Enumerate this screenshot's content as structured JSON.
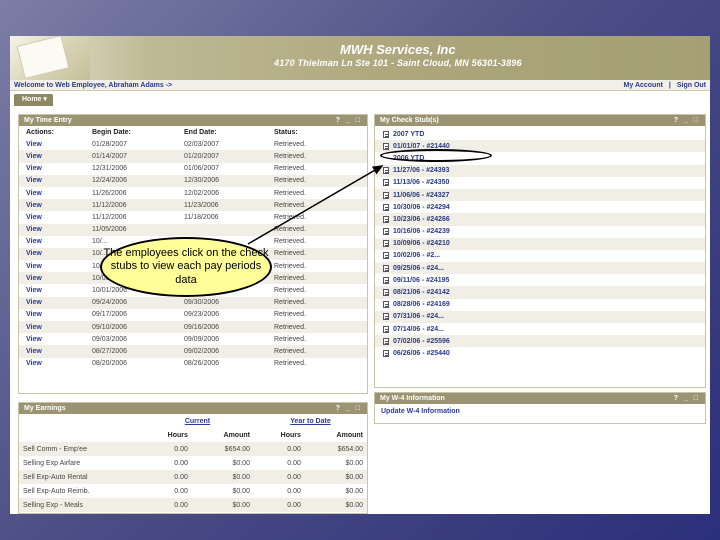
{
  "app": {
    "company_name": "MWH Services, Inc",
    "company_address": "4170 Thielman Ln Ste 101 - Saint Cloud, MN 56301-3896",
    "welcome": "Welcome to Web Employee, Abraham Adams ->",
    "links": {
      "my_account": "My Account",
      "separator": "|",
      "sign_out": "Sign Out"
    },
    "tab": "Home"
  },
  "time_entry": {
    "title": "My Time Entry",
    "controls": "? _ □",
    "headers": [
      "Actions:",
      "Begin Date:",
      "End Date:",
      "Status:"
    ],
    "rows": [
      {
        "action": "View",
        "begin": "01/28/2007",
        "end": "02/03/2007",
        "status": "Retrieved."
      },
      {
        "action": "View",
        "begin": "01/14/2007",
        "end": "01/20/2007",
        "status": "Retrieved."
      },
      {
        "action": "View",
        "begin": "12/31/2006",
        "end": "01/06/2007",
        "status": "Retrieved."
      },
      {
        "action": "View",
        "begin": "12/24/2006",
        "end": "12/30/2006",
        "status": "Retrieved."
      },
      {
        "action": "View",
        "begin": "11/26/2006",
        "end": "12/02/2006",
        "status": "Retrieved."
      },
      {
        "action": "View",
        "begin": "11/12/2006",
        "end": "11/23/2006",
        "status": "Retrieved."
      },
      {
        "action": "View",
        "begin": "11/12/2006",
        "end": "11/18/2006",
        "status": "Retrieved."
      },
      {
        "action": "View",
        "begin": "11/05/2006",
        "end": "",
        "status": "Retrieved."
      },
      {
        "action": "View",
        "begin": "10/...",
        "end": "",
        "status": "Retrieved."
      },
      {
        "action": "View",
        "begin": "10/...",
        "end": "",
        "status": "Retrieved."
      },
      {
        "action": "View",
        "begin": "10/...",
        "end": "",
        "status": "Retrieved."
      },
      {
        "action": "View",
        "begin": "10/08/2006",
        "end": "",
        "status": "Retrieved."
      },
      {
        "action": "View",
        "begin": "10/01/2006",
        "end": "10/07/2006",
        "status": "Retrieved."
      },
      {
        "action": "View",
        "begin": "09/24/2006",
        "end": "09/30/2006",
        "status": "Retrieved."
      },
      {
        "action": "View",
        "begin": "09/17/2006",
        "end": "09/23/2006",
        "status": "Retrieved."
      },
      {
        "action": "View",
        "begin": "09/10/2006",
        "end": "09/16/2006",
        "status": "Retrieved."
      },
      {
        "action": "View",
        "begin": "09/03/2006",
        "end": "09/09/2006",
        "status": "Retrieved."
      },
      {
        "action": "View",
        "begin": "08/27/2006",
        "end": "09/02/2006",
        "status": "Retrieved."
      },
      {
        "action": "View",
        "begin": "08/20/2006",
        "end": "08/26/2006",
        "status": "Retrieved."
      }
    ]
  },
  "check_stubs": {
    "title": "My Check Stub(s)",
    "controls": "? _ □",
    "items": [
      {
        "label": "2007 YTD",
        "icon": true
      },
      {
        "label": "01/01/07 - #21440",
        "icon": true
      },
      {
        "label": "2006 YTD",
        "icon": false
      },
      {
        "label": "11/27/06 - #24393",
        "icon": true
      },
      {
        "label": "11/13/06 - #24350",
        "icon": true
      },
      {
        "label": "11/06/06 - #24327",
        "icon": true
      },
      {
        "label": "10/30/06 - #24294",
        "icon": true
      },
      {
        "label": "10/23/06 - #24266",
        "icon": true
      },
      {
        "label": "10/16/06 - #24239",
        "icon": true
      },
      {
        "label": "10/09/06 - #24210",
        "icon": true
      },
      {
        "label": "10/02/06 - #2...",
        "icon": true
      },
      {
        "label": "09/25/06 - #24...",
        "icon": true
      },
      {
        "label": "09/11/06 - #24195",
        "icon": true
      },
      {
        "label": "08/21/06 - #24142",
        "icon": true
      },
      {
        "label": "08/28/06 - #24169",
        "icon": true
      },
      {
        "label": "07/31/06 - #24...",
        "icon": true
      },
      {
        "label": "07/14/06 - #24...",
        "icon": true
      },
      {
        "label": "07/02/06 - #25596",
        "icon": true
      },
      {
        "label": "06/26/06 - #25440",
        "icon": true
      }
    ]
  },
  "w4": {
    "title": "My W-4 Information",
    "controls": "? _ □",
    "link": "Update W-4 Information"
  },
  "earnings": {
    "title": "My Earnings",
    "controls": "? _ □",
    "group_headers": [
      "Current",
      "Year to Date"
    ],
    "col_headers": [
      "Hours",
      "Amount",
      "Hours",
      "Amount"
    ],
    "rows": [
      {
        "name": "Sell Comm - Emp'ee",
        "h1": "0.00",
        "a1": "$654.00",
        "h2": "0.00",
        "a2": "$654.00"
      },
      {
        "name": "Selling Exp Airfare",
        "h1": "0.00",
        "a1": "$0.00",
        "h2": "0.00",
        "a2": "$0.00"
      },
      {
        "name": "Sell Exp-Auto Rental",
        "h1": "0.00",
        "a1": "$0.00",
        "h2": "0.00",
        "a2": "$0.00"
      },
      {
        "name": "Sell Exp-Auto Reimb.",
        "h1": "0.00",
        "a1": "$0.00",
        "h2": "0.00",
        "a2": "$0.00"
      },
      {
        "name": "Selling Exp - Meals",
        "h1": "0.00",
        "a1": "$0.00",
        "h2": "0.00",
        "a2": "$0.00"
      }
    ]
  },
  "callout": {
    "text": "The employees click on the check stubs to view each pay periods data"
  }
}
